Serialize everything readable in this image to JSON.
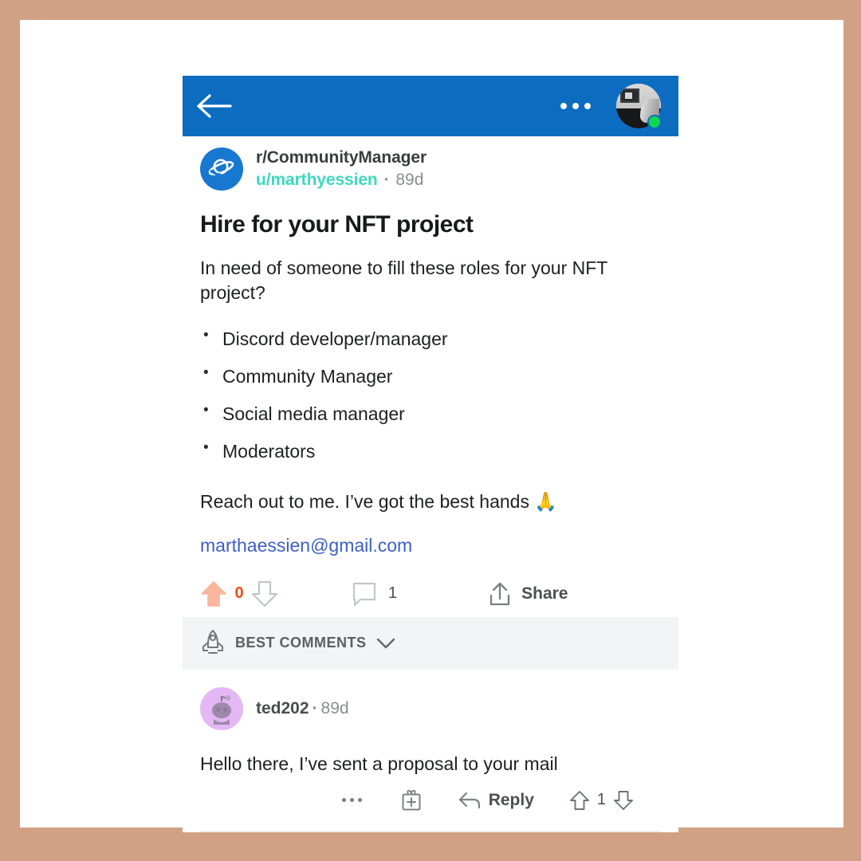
{
  "theme": {
    "frame_color": "#d2a185",
    "appbar_blue": "#0c6dc0",
    "author_teal": "#3ed8bd",
    "link_blue": "#3d5fc4",
    "upvote_orange": "#f24b10",
    "sortbar_gray": "#f2f4f5",
    "status_green": "#0fd84f"
  },
  "appbar": {
    "back_icon": "arrow-left-icon",
    "overflow_icon": "more-horizontal-icon",
    "avatar_icon": "user-avatar",
    "status": "online"
  },
  "post": {
    "subreddit_icon": "planet-icon",
    "subreddit": "r/CommunityManager",
    "author": "u/marthyessien",
    "separator": "·",
    "age": "89d",
    "title": "Hire for your NFT project",
    "intro": "In need of someone to fill these roles for your NFT project?",
    "roles": [
      "Discord developer/manager",
      "Community Manager",
      "Social media manager",
      "Moderators"
    ],
    "closing": "Reach out to me. I’ve got the best hands 🙏",
    "email": "marthaessien@gmail.com"
  },
  "post_actions": {
    "upvote_icon": "upvote-arrow-icon",
    "score": "0",
    "downvote_icon": "downvote-arrow-icon",
    "comment_icon": "comment-bubble-icon",
    "comment_count": "1",
    "share_icon": "share-icon",
    "share_label": "Share"
  },
  "sort": {
    "icon": "rocket-icon",
    "label": "BEST COMMENTS",
    "chevron": "chevron-down-icon"
  },
  "comment": {
    "avatar_icon": "snoo-avatar-icon",
    "author": "ted202",
    "separator": "·",
    "age": "89d",
    "body": "Hello there, I’ve sent a proposal to your mail",
    "actions": {
      "more_icon": "more-horizontal-icon",
      "award_icon": "gift-award-icon",
      "reply_icon": "reply-arrow-icon",
      "reply_label": "Reply",
      "upvote_icon": "upvote-arrow-icon",
      "score": "1",
      "downvote_icon": "downvote-arrow-icon"
    }
  }
}
